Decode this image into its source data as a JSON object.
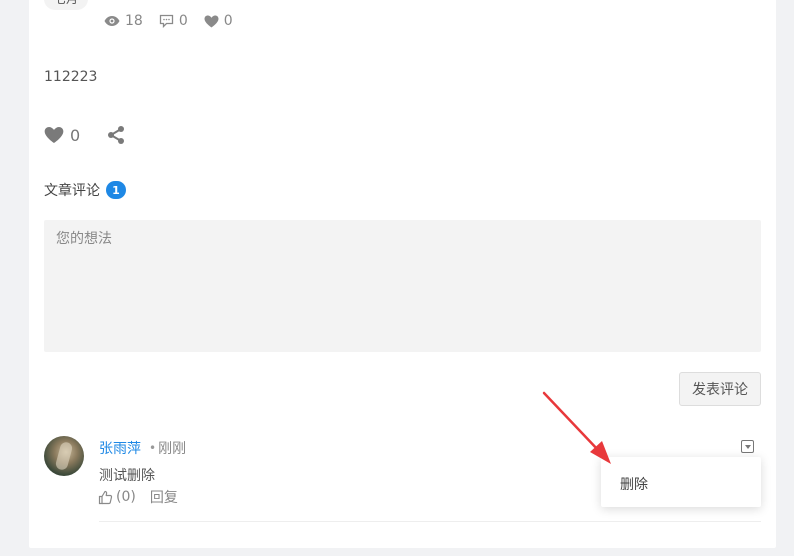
{
  "post": {
    "month_label": "七月",
    "stats": {
      "views": "18",
      "comments": "0",
      "likes": "0"
    },
    "content": "112223",
    "like_count": "0"
  },
  "comments_section": {
    "title": "文章评论",
    "count": "1",
    "input_placeholder": "您的想法",
    "submit_label": "发表评论"
  },
  "comment": {
    "author": "张雨萍",
    "separator": "•",
    "time": "刚刚",
    "text": "测试删除",
    "like_label": "(0)",
    "reply_label": "回复"
  },
  "menu": {
    "items": [
      {
        "label": "删除"
      }
    ]
  },
  "colors": {
    "accent": "#1e88e5",
    "annotation_arrow": "#e8383b"
  },
  "icons": [
    "eye-icon",
    "comment-icon",
    "heart-icon",
    "share-icon",
    "thumbs-up-icon",
    "chevron-down-icon",
    "annotation-arrow"
  ]
}
